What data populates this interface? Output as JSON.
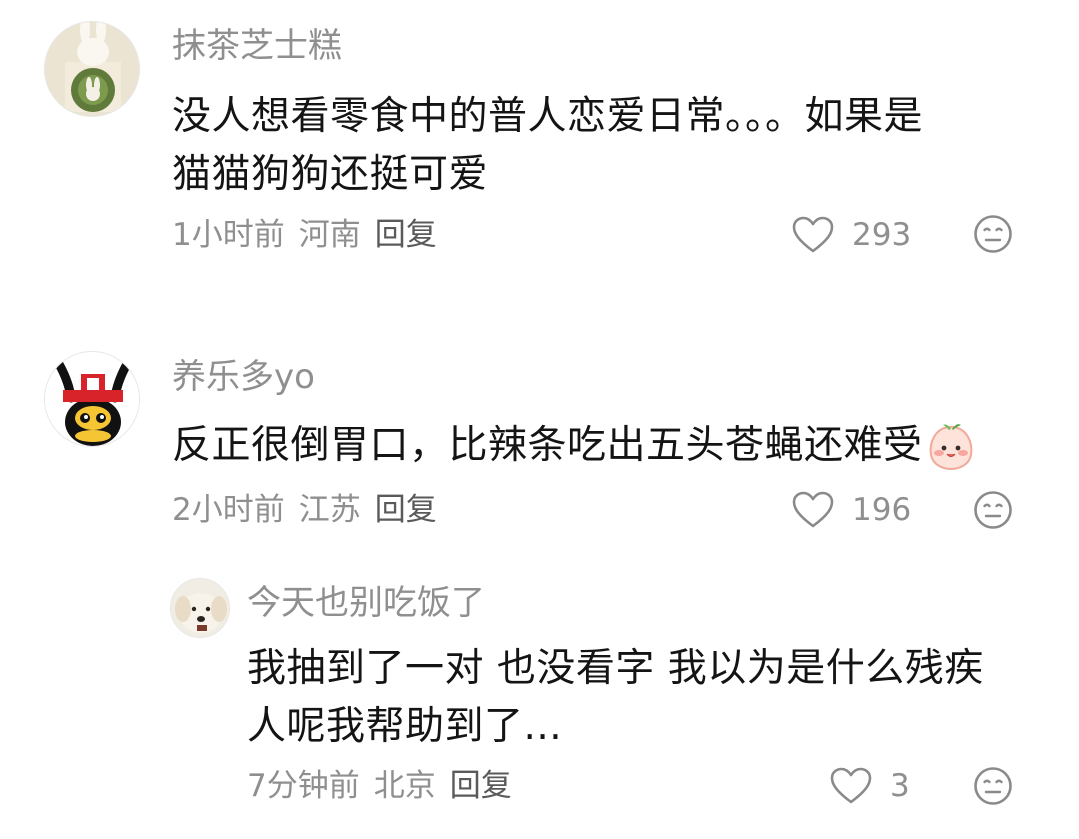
{
  "comments": [
    {
      "username": "抹茶芝士糕",
      "text_line1": "没人想看零食中的普人恋爱日常。。。如果是",
      "text_line2": "猫猫狗狗还挺可爱",
      "time": "1小时前",
      "location": "河南",
      "reply_label": "回复",
      "likes": "293"
    },
    {
      "username": "养乐多yo",
      "text_line1": "反正很倒胃口，比辣条吃出五头苍蝇还难受",
      "time": "2小时前",
      "location": "江苏",
      "reply_label": "回复",
      "likes": "196",
      "replies": [
        {
          "username": "今天也别吃饭了",
          "text_line1": "我抽到了一对 也没看字 我以为是什么残疾",
          "text_line2": "人呢我帮助到了...",
          "time": "7分钟前",
          "location": "北京",
          "reply_label": "回复",
          "likes": "3"
        }
      ]
    }
  ],
  "icons": {
    "like": "heart-outline-icon",
    "dislike": "meh-face-icon",
    "inline_emoji": "peach-face-emoji"
  }
}
